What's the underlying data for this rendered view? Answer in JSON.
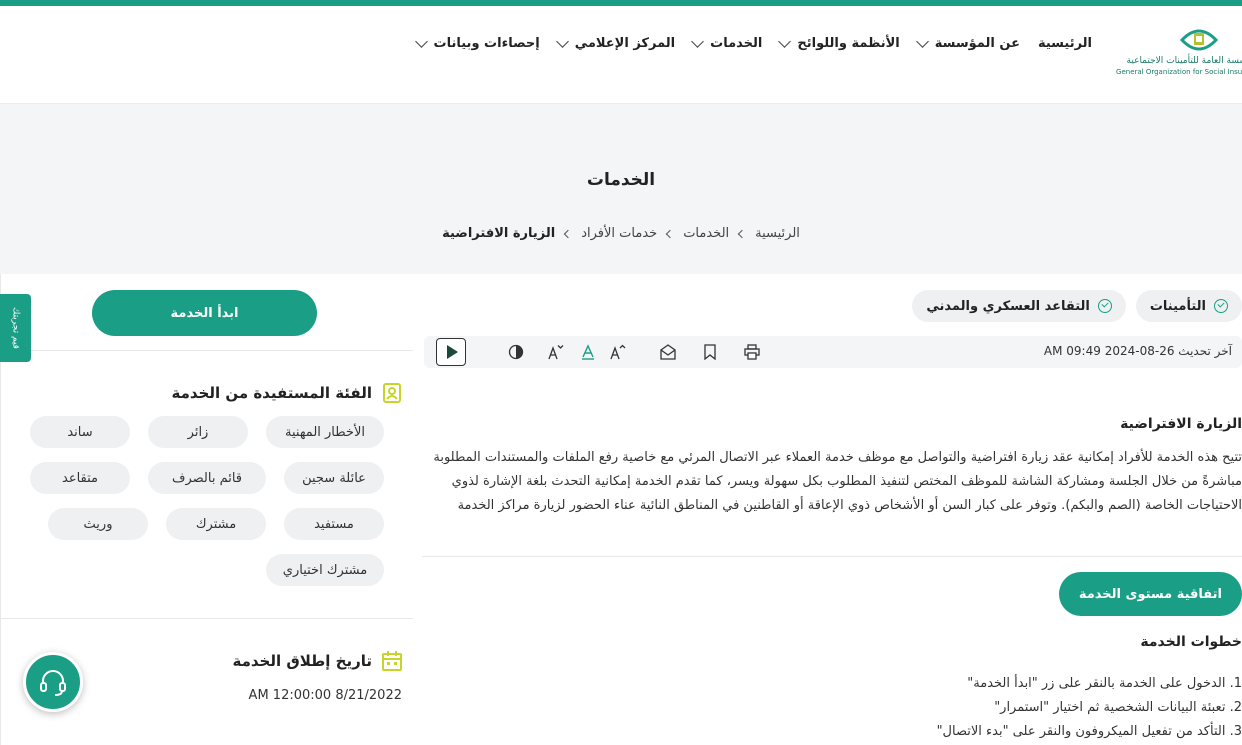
{
  "colors": {
    "primary": "#1a9e85",
    "hero_bg": "#f4f5f6",
    "chip_bg": "#eef0f2",
    "accent_yellow": "#c7d42a"
  },
  "logo": {
    "text_ar": "المؤسسة العامة للتأمينات الاجتماعية",
    "text_en": "General Organization for Social Insurance",
    "icon": "gosi-logo-icon"
  },
  "nav": [
    {
      "label": "الرئيسية",
      "has_dropdown": false
    },
    {
      "label": "عن المؤسسة",
      "has_dropdown": true
    },
    {
      "label": "الأنظمة واللوائح",
      "has_dropdown": true
    },
    {
      "label": "الخدمات",
      "has_dropdown": true
    },
    {
      "label": "المركز الإعلامي",
      "has_dropdown": true
    },
    {
      "label": "إحصاءات وبيانات",
      "has_dropdown": true
    }
  ],
  "hero": {
    "title": "الخدمات",
    "breadcrumb": [
      "الرئيسية",
      "الخدمات",
      "خدمات الأفراد",
      "الزيارة الافتراضية"
    ]
  },
  "main": {
    "chips": [
      "التأمينات",
      "التقاعد العسكري والمدني"
    ],
    "last_updated": "آخر تحديث 26-08-2024 AM 09:49",
    "toolbar_icons": [
      "print-icon",
      "bookmark-icon",
      "share-icon",
      "font-increase-icon",
      "font-normal-icon",
      "font-decrease-icon",
      "contrast-icon",
      "play-icon"
    ],
    "title": "الزيارة الافتراضية",
    "description": "تتيح هذه الخدمة للأفراد إمكانية عقد زيارة افتراضية والتواصل مع موظف خدمة العملاء عبر الاتصال المرئي مع خاصية رفع الملفات والمستندات المطلوبة مباشرةً من خلال الجلسة ومشاركة الشاشة للموظف المختص لتنفيذ المطلوب بكل سهولة ويسر، كما تقدم الخدمة إمكانية التحدث بلغة الإشارة لذوي الاحتياجات الخاصة (الصم والبكم). وتوفر على كبار السن أو الأشخاص ذوي الإعاقة أو القاطنين في المناطق النائية عناء الحضور لزيارة مراكز الخدمة",
    "sla_button": "اتفاقية مستوى الخدمة",
    "steps_title": "خطوات الخدمة",
    "steps": [
      "1. الدخول على الخدمة بالنقر على زر \"ابدأ الخدمة\"",
      "2. تعبئة البيانات الشخصية ثم اختيار \"استمرار\"",
      "3. التأكد من تفعيل الميكروفون والنقر على \"بدء الاتصال\""
    ]
  },
  "sidebar": {
    "start_button": "ابدأ الخدمة",
    "beneficiary_title": "الفئة المستفيدة من الخدمة",
    "beneficiaries": [
      "الأخطار المهنية",
      "زائر",
      "ساند",
      "عائلة سجين",
      "قائم بالصرف",
      "متقاعد",
      "مستفيد",
      "مشترك",
      "وريث",
      "مشترك اختياري"
    ],
    "launch_title": "تاريخ إطلاق الخدمة",
    "launch_date": "8/21/2022 12:00:00 AM"
  },
  "feedback_tab": "قيم تجربتك",
  "support_icon": "headset-icon"
}
